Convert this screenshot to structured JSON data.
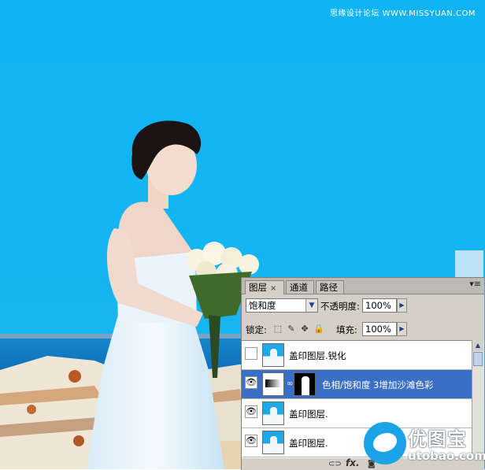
{
  "watermark_top": "思缘设计论坛 WWW.MISSYUAN.COM",
  "panel": {
    "tabs": [
      {
        "label": "图层",
        "close": "×",
        "active": true
      },
      {
        "label": "通道",
        "active": false
      },
      {
        "label": "路径",
        "active": false
      }
    ],
    "menu_icon": "▾≡",
    "blend_mode": "饱和度",
    "opacity_label": "不透明度:",
    "opacity_value": "100%",
    "lock_label": "锁定:",
    "fill_label": "填充:",
    "fill_value": "100%",
    "lock_icons": [
      "lock-transparent-icon",
      "lock-brush-icon",
      "lock-move-icon",
      "lock-all-icon"
    ],
    "layers": [
      {
        "name": "盖印图层.锐化",
        "visible": false,
        "selected": false,
        "type": "photo"
      },
      {
        "name": "色相/饱和度 3增加沙滩色彩",
        "visible": true,
        "selected": true,
        "type": "adjustment"
      },
      {
        "name": "盖印图层.",
        "visible": true,
        "selected": false,
        "type": "photo"
      },
      {
        "name": "盖印图层.",
        "visible": true,
        "selected": false,
        "type": "photo"
      }
    ],
    "footer_fx": "fx."
  },
  "logo": {
    "cn": "优图宝",
    "en": "utobao.com"
  },
  "colors": {
    "sky": "#12b2f0",
    "panel_bg": "#d4d0c8",
    "selected_layer": "#3a6fc6"
  }
}
